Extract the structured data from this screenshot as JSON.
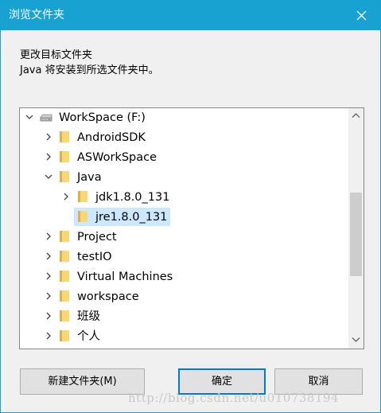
{
  "window": {
    "title": "浏览文件夹"
  },
  "description": {
    "line1": "更改目标文件夹",
    "line2": "Java 将安装到所选文件夹中。"
  },
  "tree": {
    "items": [
      {
        "label": "WorkSpace (F:)",
        "icon": "drive-icon",
        "chevron": "expanded",
        "level": 0
      },
      {
        "label": "AndroidSDK",
        "icon": "folder-icon",
        "chevron": "collapsed",
        "level": 1
      },
      {
        "label": "ASWorkSpace",
        "icon": "folder-icon",
        "chevron": "collapsed",
        "level": 1
      },
      {
        "label": "Java",
        "icon": "folder-icon",
        "chevron": "expanded",
        "level": 1
      },
      {
        "label": "jdk1.8.0_131",
        "icon": "folder-icon",
        "chevron": "collapsed",
        "level": 2
      },
      {
        "label": "jre1.8.0_131",
        "icon": "folder-icon",
        "chevron": "none",
        "level": 2,
        "selected": true
      },
      {
        "label": "Project",
        "icon": "folder-icon",
        "chevron": "collapsed",
        "level": 1
      },
      {
        "label": "testIO",
        "icon": "folder-icon",
        "chevron": "collapsed",
        "level": 1
      },
      {
        "label": "Virtual Machines",
        "icon": "folder-icon",
        "chevron": "collapsed",
        "level": 1
      },
      {
        "label": "workspace",
        "icon": "folder-icon",
        "chevron": "collapsed",
        "level": 1
      },
      {
        "label": "班级",
        "icon": "folder-icon",
        "chevron": "collapsed",
        "level": 1
      },
      {
        "label": "个人",
        "icon": "folder-icon",
        "chevron": "collapsed",
        "level": 1
      }
    ]
  },
  "buttons": {
    "new_folder": "新建文件夹(M)",
    "ok": "确定",
    "cancel": "取消"
  },
  "watermark": "http://blog.csdn.net/u010738194",
  "colors": {
    "titlebar": "#17a2d1",
    "selection": "#cce8ff",
    "folder": "#f8d775",
    "default_button_border": "#0078d7"
  }
}
